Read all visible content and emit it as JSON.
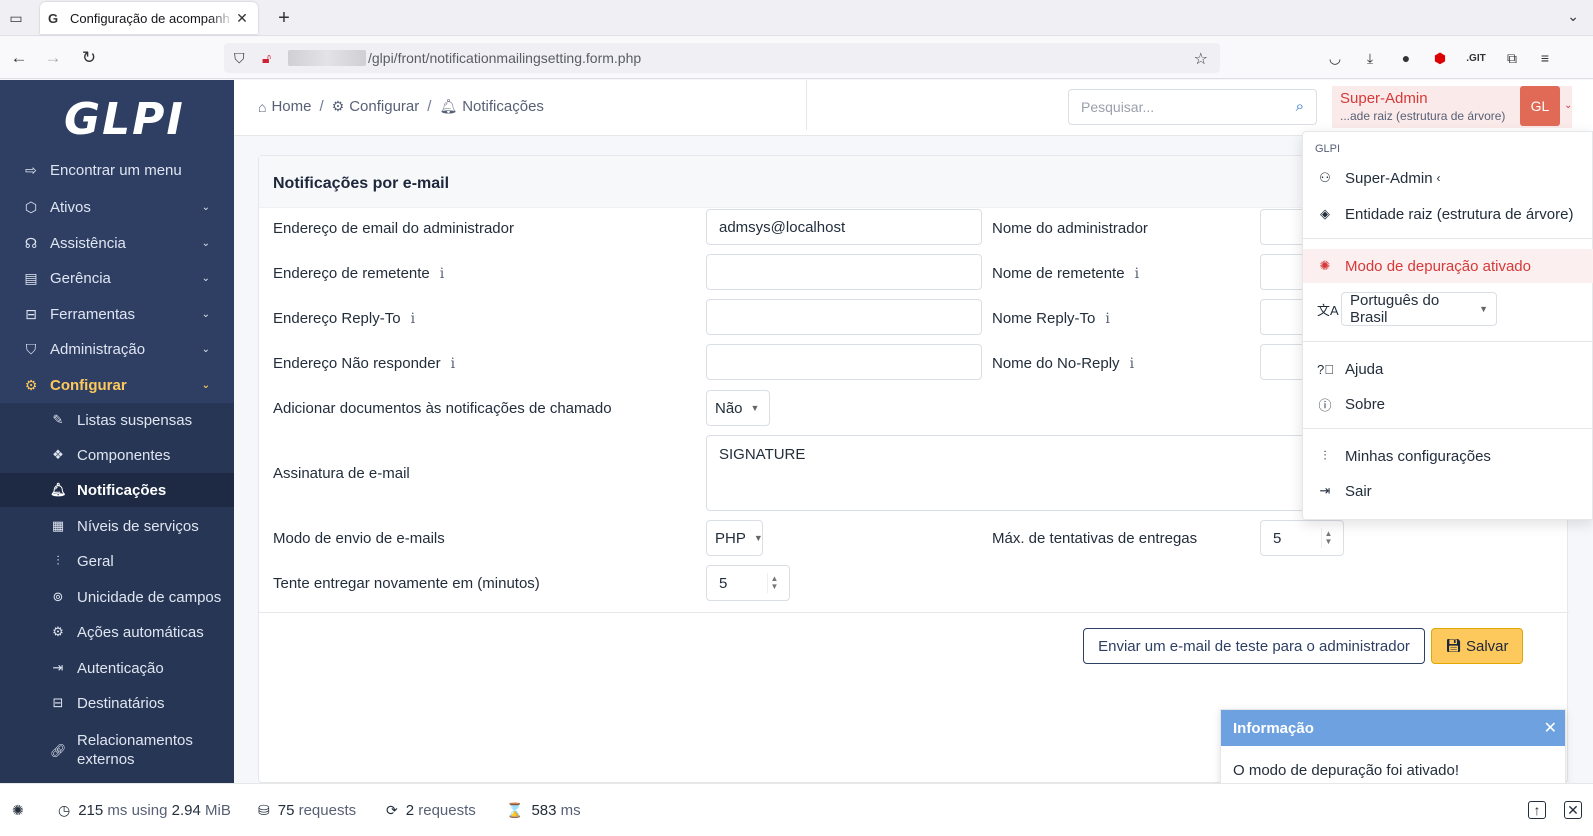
{
  "browser": {
    "tab_title": "Configuração de acompanh",
    "tab_favicon": "G",
    "url": "/glpi/front/notificationmailingsetting.form.php"
  },
  "sidebar": {
    "logo": "GLPI",
    "find_menu": "Encontrar um menu",
    "items": [
      {
        "label": "Ativos",
        "icon": "cube-icon"
      },
      {
        "label": "Assistência",
        "icon": "headset-icon"
      },
      {
        "label": "Gerência",
        "icon": "wallet-icon"
      },
      {
        "label": "Ferramentas",
        "icon": "briefcase-icon"
      },
      {
        "label": "Administração",
        "icon": "shield-icon"
      },
      {
        "label": "Configurar",
        "icon": "gear-icon"
      }
    ],
    "subitems": [
      {
        "label": "Listas suspensas"
      },
      {
        "label": "Componentes"
      },
      {
        "label": "Notificações"
      },
      {
        "label": "Níveis de serviços"
      },
      {
        "label": "Geral"
      },
      {
        "label": "Unicidade de campos"
      },
      {
        "label": "Ações automáticas"
      },
      {
        "label": "Autenticação"
      },
      {
        "label": "Destinatários"
      },
      {
        "label": "Relacionamentos externos"
      }
    ]
  },
  "header": {
    "breadcrumb": [
      "Home",
      "Configurar",
      "Notificações"
    ],
    "search_placeholder": "Pesquisar...",
    "user_name": "Super-Admin",
    "user_entity": "...ade raiz (estrutura de árvore)",
    "avatar": "GL"
  },
  "form": {
    "title": "Notificações por e-mail",
    "admin_email_label": "Endereço de email do administrador",
    "admin_email_value": "admsys@localhost",
    "admin_name_label": "Nome do administrador",
    "sender_address_label": "Endereço de remetente",
    "sender_name_label": "Nome de remetente",
    "replyto_address_label": "Endereço Reply-To",
    "replyto_name_label": "Nome Reply-To",
    "noreply_address_label": "Endereço Não responder",
    "noreply_name_label": "Nome do No-Reply",
    "attach_docs_label": "Adicionar documentos às notificações de chamado",
    "attach_docs_value": "Não",
    "signature_label": "Assinatura de e-mail",
    "signature_value": "SIGNATURE",
    "mode_label": "Modo de envio de e-mails",
    "mode_value": "PHP",
    "max_tries_label": "Máx. de tentativas de entregas",
    "max_tries_value": "5",
    "retry_label": "Tente entregar novamente em (minutos)",
    "retry_value": "5",
    "test_button": "Enviar um e-mail de teste para o administrador",
    "save_button": "Salvar"
  },
  "dropdown": {
    "header": "GLPI",
    "profile": "Super-Admin",
    "entity": "Entidade raiz (estrutura de árvore)",
    "debug": "Modo de depuração ativado",
    "language": "Português do Brasil",
    "help": "Ajuda",
    "about": "Sobre",
    "settings": "Minhas configurações",
    "logout": "Sair"
  },
  "toast": {
    "title": "Informação",
    "message": "O modo de depuração foi ativado!"
  },
  "debugbar": {
    "time_value": "215",
    "time_unit": "ms using",
    "memory": "2.94",
    "memory_unit": "MiB",
    "requests": "75",
    "requests_label": "requests",
    "ajax_requests": "2",
    "ajax_label": "requests",
    "server_time": "583",
    "server_unit": "ms"
  },
  "colors": {
    "sidebar_bg": "#2f3f64",
    "accent": "#fec95c",
    "debug_red": "#d63939",
    "toast_blue": "#6ea1e0"
  }
}
